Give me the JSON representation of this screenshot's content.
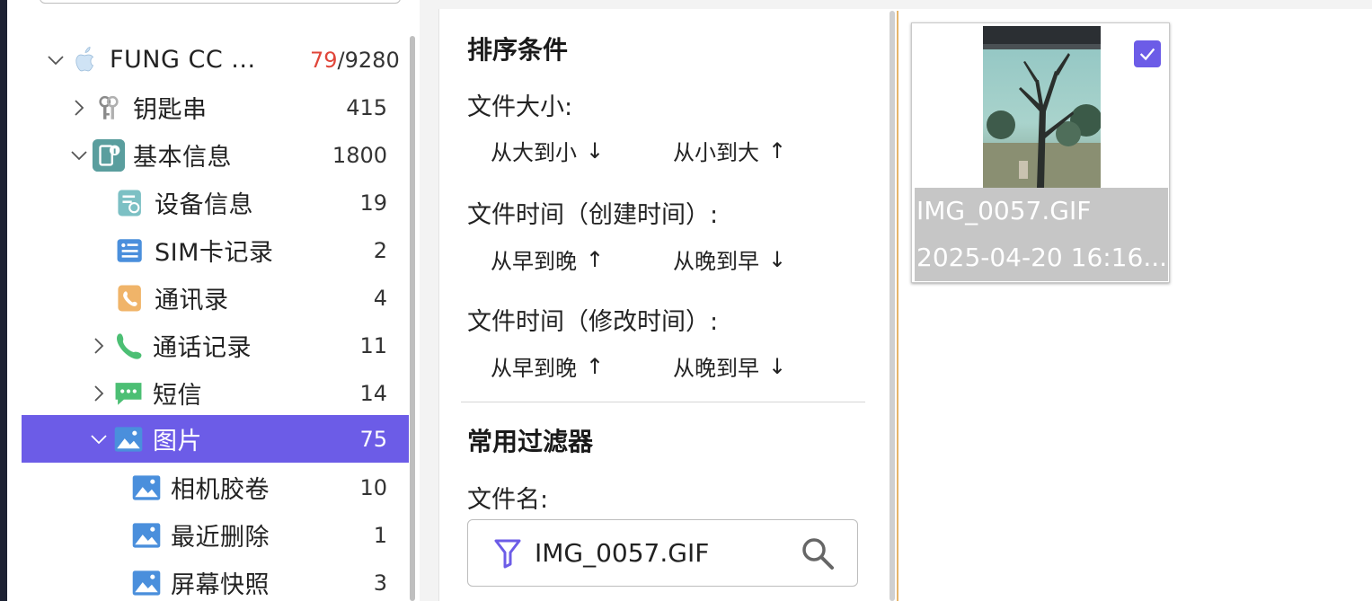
{
  "tree": {
    "root": {
      "label": "FUNG  CC ...",
      "count_highlight": "79",
      "count_rest": "/9280",
      "icon": "apple-icon"
    },
    "items": [
      {
        "label": "钥匙串",
        "count": "415",
        "icon": "keychain-icon"
      },
      {
        "label": "基本信息",
        "count": "1800",
        "icon": "device-info-icon"
      },
      {
        "label": "设备信息",
        "count": "19",
        "icon": "device-details-icon"
      },
      {
        "label": "SIM卡记录",
        "count": "2",
        "icon": "sim-card-icon"
      },
      {
        "label": "通讯录",
        "count": "4",
        "icon": "contacts-icon"
      },
      {
        "label": "通话记录",
        "count": "11",
        "icon": "phone-icon"
      },
      {
        "label": "短信",
        "count": "14",
        "icon": "message-icon"
      },
      {
        "label": "图片",
        "count": "75",
        "icon": "picture-icon"
      },
      {
        "label": "相机胶卷",
        "count": "10",
        "icon": "picture-icon"
      },
      {
        "label": "最近删除",
        "count": "1",
        "icon": "picture-icon"
      },
      {
        "label": "屏幕快照",
        "count": "3",
        "icon": "picture-icon"
      }
    ]
  },
  "sort": {
    "title": "排序条件",
    "file_size": {
      "label": "文件大小:",
      "desc": "从大到小",
      "desc_arrow": "↓",
      "asc": "从小到大",
      "asc_arrow": "↑"
    },
    "created": {
      "label": "文件时间（创建时间）:",
      "early": "从早到晚",
      "early_arrow": "↑",
      "late": "从晚到早",
      "late_arrow": "↓"
    },
    "modified": {
      "label": "文件时间（修改时间）:",
      "early": "从早到晚",
      "early_arrow": "↑",
      "late": "从晚到早",
      "late_arrow": "↓"
    }
  },
  "filters": {
    "title": "常用过滤器",
    "filename_label": "文件名:",
    "filename_value": "IMG_0057.GIF"
  },
  "thumbnail": {
    "filename": "IMG_0057.GIF",
    "datetime": "2025-04-20 16:16...",
    "checked": true
  },
  "colors": {
    "accent": "#6c5ce7",
    "count_highlight": "#e0463a",
    "divider": "#e6b56a"
  }
}
